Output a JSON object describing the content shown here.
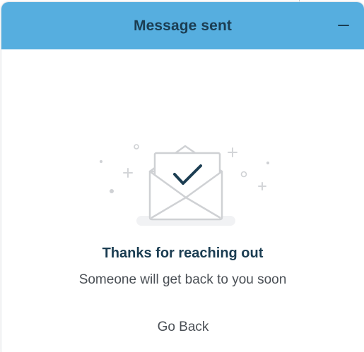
{
  "header": {
    "title": "Message sent",
    "minimize_icon": "minus-icon",
    "background": "#56aedf",
    "text_color": "#1b3d52"
  },
  "confirmation": {
    "illustration_icon": "envelope-checkmark-icon",
    "title": "Thanks for reaching out",
    "message": "Someone will get back to you soon"
  },
  "actions": {
    "go_back_label": "Go Back"
  }
}
